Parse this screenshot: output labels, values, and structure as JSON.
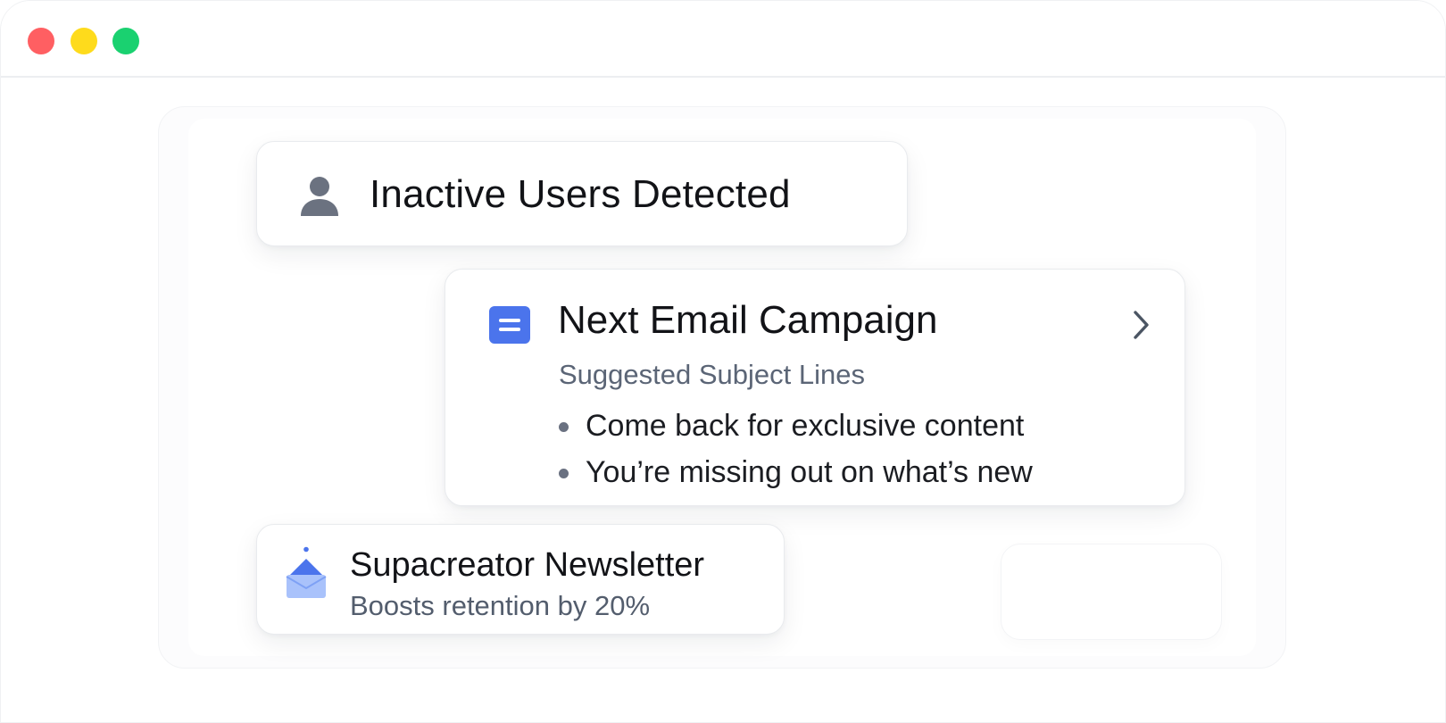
{
  "window": {
    "controls": [
      "close",
      "minimize",
      "maximize"
    ],
    "colors": {
      "close": "#ff5f62",
      "minimize": "#fedb1c",
      "maximize": "#1ad170"
    }
  },
  "inactive_card": {
    "icon": "user-icon",
    "title": "Inactive Users Detected"
  },
  "email_card": {
    "icon": "document-icon",
    "title": "Next Email Campaign",
    "subtitle": "Suggested Subject Lines",
    "subject_lines": [
      "Come back for exclusive content",
      "You’re missing out on what’s new"
    ],
    "action_icon": "chevron-right-icon",
    "accent_color": "#4b74ec"
  },
  "newsletter_card": {
    "icon": "open-envelope-icon",
    "title": "Supacreator Newsletter",
    "subtitle": "Boosts retention by 20%"
  }
}
